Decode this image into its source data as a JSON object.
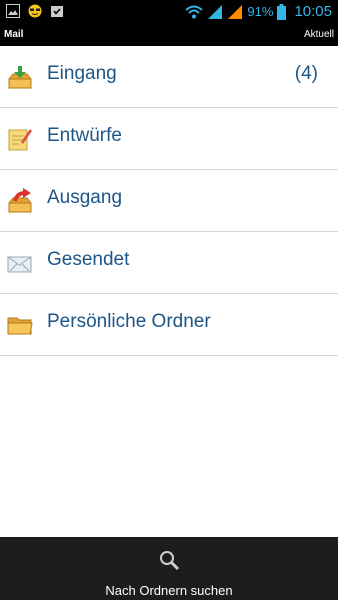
{
  "status_bar": {
    "battery": "91%",
    "time": "10:05",
    "icons": [
      "image-icon",
      "sunglasses-emoji-icon",
      "task-check-icon",
      "wifi-icon",
      "signal-icon",
      "battery-icon"
    ],
    "accent_color": "#35b4e6"
  },
  "app_bar": {
    "title": "Mail",
    "action": "Aktuell"
  },
  "folders": [
    {
      "label": "Eingang",
      "count": "(4)",
      "icon": "inbox-icon"
    },
    {
      "label": "Entwürfe",
      "count": "",
      "icon": "drafts-icon"
    },
    {
      "label": "Ausgang",
      "count": "",
      "icon": "outbox-icon"
    },
    {
      "label": "Gesendet",
      "count": "",
      "icon": "sent-icon"
    },
    {
      "label": "Persönliche Ordner",
      "count": "",
      "icon": "folder-icon"
    }
  ],
  "bottom_bar": {
    "search_label": "Nach Ordnern suchen",
    "icon": "search-icon"
  },
  "colors": {
    "label": "#1d5586",
    "divider": "#d6d6d6",
    "bottom_bar": "#1d1d1d"
  }
}
